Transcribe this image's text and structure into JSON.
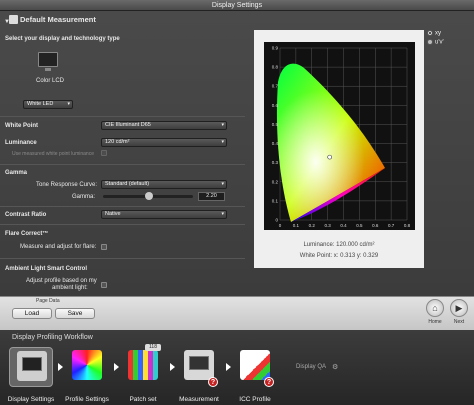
{
  "window": {
    "title": "Display Settings"
  },
  "section": {
    "title": "Default Measurement"
  },
  "display": {
    "prompt": "Select your display and technology type",
    "device_label": "Color LCD",
    "technology": "White LED"
  },
  "settings": {
    "white_point_label": "White Point",
    "white_point_value": "CIE Illuminant D65",
    "luminance_label": "Luminance",
    "luminance_value": "120 cd/m²",
    "measured_wp_label": "Use measured white point luminance",
    "gamma_label": "Gamma",
    "trc_label": "Tone Response Curve:",
    "trc_value": "Standard (default)",
    "gamma_value_label": "Gamma:",
    "gamma_value": "2.20",
    "contrast_label": "Contrast Ratio",
    "contrast_value": "Native",
    "flare_label": "Flare Correct™",
    "flare_option": "Measure and adjust for flare:",
    "ambient_label": "Ambient Light Smart Control",
    "ambient_option_line1": "Adjust profile based on my",
    "ambient_option_line2": "ambient light:"
  },
  "chart_data": {
    "type": "scatter",
    "title": "",
    "x_ticks": [
      "0",
      "0.1",
      "0.2",
      "0.3",
      "0.4",
      "0.5",
      "0.6",
      "0.7",
      "0.8"
    ],
    "y_ticks": [
      "0",
      "0.1",
      "0.2",
      "0.3",
      "0.4",
      "0.5",
      "0.6",
      "0.7",
      "0.8",
      "0.9"
    ],
    "xlim": [
      0,
      0.8
    ],
    "ylim": [
      0,
      0.9
    ],
    "white_point": {
      "x": 0.313,
      "y": 0.329
    },
    "luminance_caption": "Luminance: 120.000 cd/m²",
    "white_point_caption": "White Point: x: 0.313  y: 0.329",
    "modes": [
      "xy",
      "u'v'"
    ],
    "selected_mode": "xy"
  },
  "buttons": {
    "group_label": "Page Data",
    "load": "Load",
    "save": "Save",
    "home": "Home",
    "next": "Next"
  },
  "workflow": {
    "title": "Display Profiling Workflow",
    "steps": [
      "Display Settings",
      "Profile Settings",
      "Patch set",
      "Measurement",
      "ICC Profile"
    ],
    "patch_count": "118",
    "display_qa": "Display QA"
  }
}
